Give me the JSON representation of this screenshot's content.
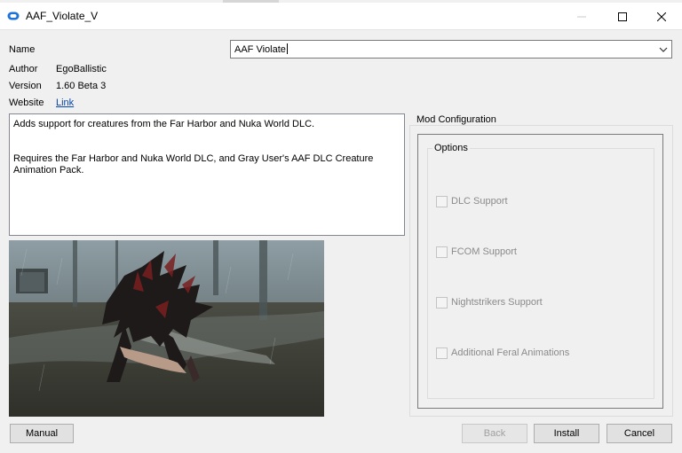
{
  "window": {
    "title": "AAF_Violate_V"
  },
  "fields": {
    "name_label": "Name",
    "name_value": "AAF Violate",
    "author_label": "Author",
    "author_value": "EgoBallistic",
    "version_label": "Version",
    "version_value": "1.60 Beta 3",
    "website_label": "Website",
    "website_link": "Link"
  },
  "description": {
    "line1": "Adds support for creatures from the Far Harbor and Nuka World DLC.",
    "line2": "Requires the Far Harbor and Nuka World DLC, and Gray User's AAF DLC Creature Animation Pack."
  },
  "mod_configuration": {
    "label": "Mod Configuration",
    "options_label": "Options",
    "options": [
      {
        "label": "DLC Support",
        "checked": false,
        "enabled": false
      },
      {
        "label": "FCOM Support",
        "checked": false,
        "enabled": false
      },
      {
        "label": "Nightstrikers Support",
        "checked": false,
        "enabled": false
      },
      {
        "label": "Additional Feral Animations",
        "checked": false,
        "enabled": false
      }
    ]
  },
  "buttons": {
    "manual": "Manual",
    "back": "Back",
    "install": "Install",
    "cancel": "Cancel"
  },
  "colors": {
    "background": "#f0f0f0",
    "link": "#0645ad",
    "disabled_text": "#8a8a8a"
  }
}
